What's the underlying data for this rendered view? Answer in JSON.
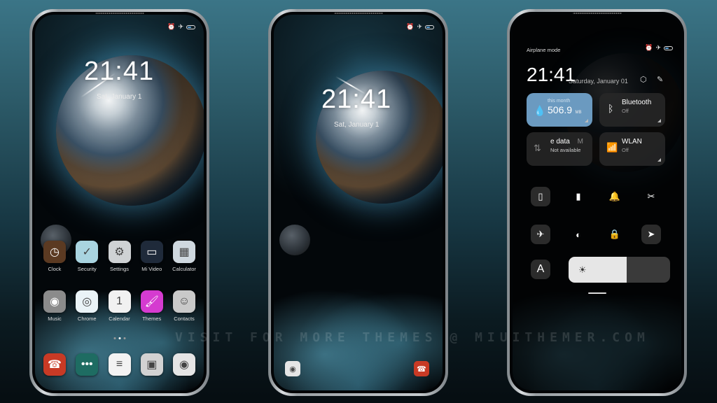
{
  "status_bar": {
    "icons": [
      "alarm-icon",
      "airplane-icon",
      "battery-icon"
    ],
    "battery_color": "#5aa0d8"
  },
  "home_screen": {
    "time": "21:41",
    "date": "Sat, January 1",
    "apps_row1": [
      {
        "label": "Clock",
        "icon": "clock-icon",
        "glyph": "◷",
        "bg": "#5b3a22"
      },
      {
        "label": "Security",
        "icon": "shield-icon",
        "glyph": "✓",
        "bg": "#a9d4e0"
      },
      {
        "label": "Settings",
        "icon": "gear-icon",
        "glyph": "⚙",
        "bg": "#cfd2d4"
      },
      {
        "label": "Mi Video",
        "icon": "video-icon",
        "glyph": "▭",
        "bg": "#1f2a3a"
      },
      {
        "label": "Calculator",
        "icon": "calculator-icon",
        "glyph": "▦",
        "bg": "#cfd8df"
      }
    ],
    "apps_row2": [
      {
        "label": "Music",
        "icon": "music-icon",
        "glyph": "◉",
        "bg": "#8b8b8b"
      },
      {
        "label": "Chrome",
        "icon": "chrome-icon",
        "glyph": "◎",
        "bg": "#eaf3f7"
      },
      {
        "label": "Calendar",
        "icon": "calendar-icon",
        "glyph": "1",
        "bg": "#f1f1f1"
      },
      {
        "label": "Themes",
        "icon": "paint-roller-icon",
        "glyph": "🖌",
        "bg": "#d53bd0"
      },
      {
        "label": "Contacts",
        "icon": "contacts-icon",
        "glyph": "☺",
        "bg": "#c9c9c9"
      }
    ],
    "page_dots": {
      "count": 3,
      "active": 1
    },
    "dock": [
      {
        "icon": "phone-icon",
        "glyph": "☎",
        "bg": "#c83a25"
      },
      {
        "icon": "messages-icon",
        "glyph": "•••",
        "bg": "#1e6c62"
      },
      {
        "icon": "notes-icon",
        "glyph": "≡",
        "bg": "#f3f3f3"
      },
      {
        "icon": "gallery-icon",
        "glyph": "▣",
        "bg": "#d2d2d2"
      },
      {
        "icon": "camera-icon",
        "glyph": "◉",
        "bg": "#e5e5e5"
      }
    ]
  },
  "lock_screen": {
    "time": "21:41",
    "date": "Sat, January 1",
    "shortcuts": [
      {
        "icon": "camera-icon",
        "glyph": "◉",
        "bg": "#e5e5e5"
      },
      {
        "icon": "phone-icon",
        "glyph": "☎",
        "bg": "#c83a25"
      }
    ]
  },
  "control_center": {
    "mode_label": "Airplane mode",
    "time": "21:41",
    "date": "Saturday, January 01",
    "tiles": [
      {
        "title": "506.9",
        "unit": "MB",
        "subtitle": "this month",
        "icon": "water-drop-icon",
        "active": true,
        "color": "#6b9ac0"
      },
      {
        "title": "Bluetooth",
        "subtitle": "Off",
        "icon": "bluetooth-icon",
        "active": false
      },
      {
        "title": "e data",
        "title_suffix": "M",
        "subtitle": "Not available",
        "icon": "mobile-data-icon",
        "active": false
      },
      {
        "title": "WLAN",
        "subtitle": "Off",
        "icon": "wifi-icon",
        "active": false
      }
    ],
    "toggles_row1": [
      {
        "icon": "vibrate-icon",
        "glyph": "▯",
        "on": true
      },
      {
        "icon": "flashlight-icon",
        "glyph": "▮",
        "on": false
      },
      {
        "icon": "bell-icon",
        "glyph": "🔔",
        "on": false
      },
      {
        "icon": "screenshot-icon",
        "glyph": "✂",
        "on": false
      }
    ],
    "toggles_row2": [
      {
        "icon": "airplane-icon",
        "glyph": "✈",
        "on": true
      },
      {
        "icon": "dark-mode-icon",
        "glyph": "◐",
        "on": false
      },
      {
        "icon": "lock-icon",
        "glyph": "🔒",
        "on": false
      },
      {
        "icon": "location-icon",
        "glyph": "➤",
        "on": true
      }
    ],
    "auto_brightness_label": "A",
    "brightness_level": 0.57
  },
  "watermark": "VISIT FOR MORE THEMES @ MIUITHEMER.COM"
}
